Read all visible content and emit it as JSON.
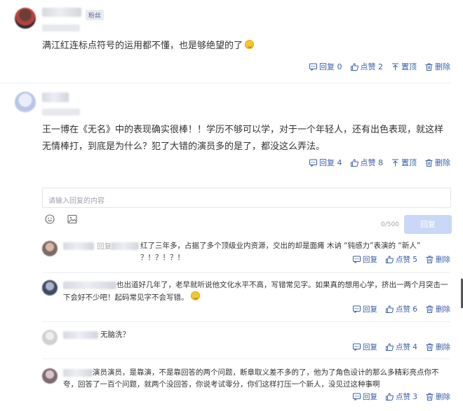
{
  "comments": [
    {
      "badge": "粉丝",
      "text": "满江红连标点符号的运用都不懂，也是够绝望的了",
      "actions": {
        "reply": "回复 0",
        "like": "点赞 2",
        "pin": "置顶",
        "delete": "删除"
      }
    },
    {
      "text": "王一博在《无名》中的表现确实很棒！！学历不够可以学，对于一个年轻人，还有出色表现，就这样无情棒打，到底是为什么？犯了大错的演员多的是了，都没这么弄法。",
      "actions": {
        "reply": "回复 4",
        "like": "点赞 8",
        "pin": "置顶",
        "delete": "删除"
      }
    }
  ],
  "reply_box": {
    "placeholder": "请输入回复的内容",
    "counter": "0/500",
    "submit_label": "回复"
  },
  "replies": [
    {
      "prefix": "回复",
      "text": "红了三年多，占据了多个顶级业内资源，交出的却是面瘫 木讷 “钝感力”表演的 “新人” ？！？！？！",
      "actions": {
        "reply": "回复",
        "like": "点赞 5",
        "delete": "删除"
      }
    },
    {
      "text": "也出道好几年了，老早就听说他文化水平不高，写错常见字。如果真的想用心学，挤出一两个月突击一下会好不少吧！起码常见字不会写错。",
      "actions": {
        "reply": "回复",
        "like": "点赞 6",
        "delete": "删除"
      }
    },
    {
      "text": "无脑洗？",
      "actions": {
        "reply": "回复",
        "like": "点赞 4",
        "delete": "删除"
      }
    },
    {
      "text": "演员演员，是靠演，不是靠回答的两个问题，断章取义差不多的了，他为了角色设计的那么多精彩亮点你不夸，回答了一百个问题，就两个没回答，你说考试零分，你们这样打压一个新人，没见过这种事啊",
      "actions": {
        "reply": "回复",
        "like": "点赞 3",
        "delete": "删除"
      }
    }
  ],
  "colors": {
    "link": "#3a5da8",
    "button_disabled": "#c9d8f6",
    "divider": "#eceef2"
  }
}
